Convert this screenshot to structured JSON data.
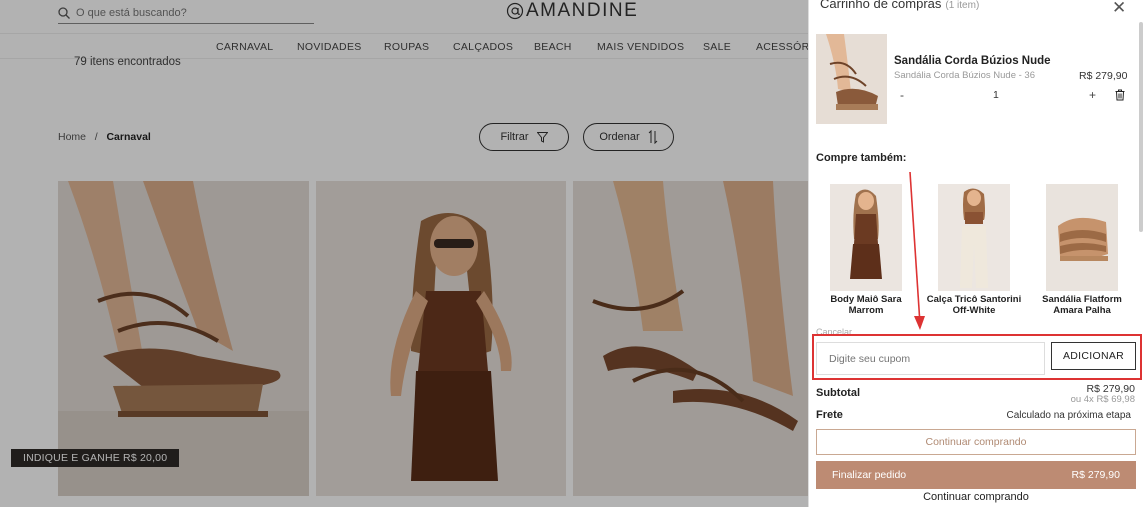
{
  "header": {
    "search_placeholder": "O que está buscando?",
    "logo": "AMANDINE"
  },
  "nav": [
    "CARNAVAL",
    "NOVIDADES",
    "ROUPAS",
    "CALÇADOS",
    "BEACH",
    "MAIS VENDIDOS",
    "SALE",
    "ACESSÓRI"
  ],
  "listing": {
    "count": "79 itens encontrados",
    "breadcrumb": {
      "home": "Home",
      "sep": "/",
      "current": "Carnaval"
    },
    "filter_label": "Filtrar",
    "sort_label": "Ordenar",
    "badge": "INDIQUE E GANHE R$ 20,00"
  },
  "cart": {
    "title": "Carrinho de compras",
    "count": "(1 item)",
    "item": {
      "name": "Sandália Corda Búzios Nude",
      "variant": "Sandália Corda Búzios Nude - 36",
      "price": "R$ 279,90",
      "qty": "1",
      "minus": "-",
      "plus": "+"
    },
    "also_title": "Compre também:",
    "recommendations": [
      {
        "name": "Body Maiô Sara Marrom"
      },
      {
        "name": "Calça Tricô Santorini Off-White"
      },
      {
        "name": "Sandália Flatform Amara Palha"
      }
    ],
    "cancel_label": "Cancelar",
    "coupon_placeholder": "Digite seu cupom",
    "add_label": "ADICIONAR",
    "subtotal_label": "Subtotal",
    "subtotal_value": "R$ 279,90",
    "installments": "ou 4x R$ 69,98",
    "shipping_label": "Frete",
    "shipping_value": "Calculado na próxima etapa",
    "continue_label": "Continuar comprando",
    "checkout_label": "Finalizar pedido",
    "checkout_value": "R$ 279,90",
    "continue2_label": "Continuar comprando"
  },
  "colors": {
    "accent": "#bd8b73",
    "highlight": "#dd3333"
  }
}
